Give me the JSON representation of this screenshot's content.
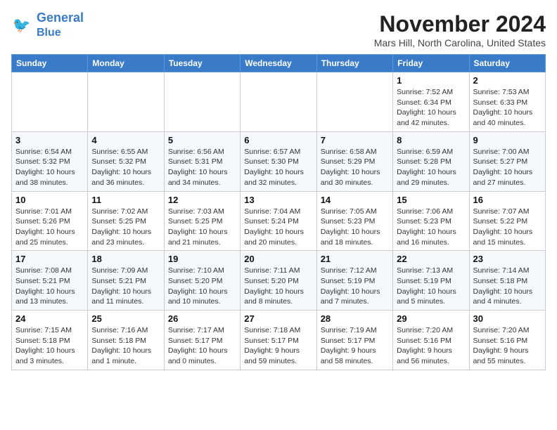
{
  "header": {
    "logo_line1": "General",
    "logo_line2": "Blue",
    "month": "November 2024",
    "location": "Mars Hill, North Carolina, United States"
  },
  "weekdays": [
    "Sunday",
    "Monday",
    "Tuesday",
    "Wednesday",
    "Thursday",
    "Friday",
    "Saturday"
  ],
  "weeks": [
    [
      {
        "day": "",
        "info": ""
      },
      {
        "day": "",
        "info": ""
      },
      {
        "day": "",
        "info": ""
      },
      {
        "day": "",
        "info": ""
      },
      {
        "day": "",
        "info": ""
      },
      {
        "day": "1",
        "info": "Sunrise: 7:52 AM\nSunset: 6:34 PM\nDaylight: 10 hours\nand 42 minutes."
      },
      {
        "day": "2",
        "info": "Sunrise: 7:53 AM\nSunset: 6:33 PM\nDaylight: 10 hours\nand 40 minutes."
      }
    ],
    [
      {
        "day": "3",
        "info": "Sunrise: 6:54 AM\nSunset: 5:32 PM\nDaylight: 10 hours\nand 38 minutes."
      },
      {
        "day": "4",
        "info": "Sunrise: 6:55 AM\nSunset: 5:32 PM\nDaylight: 10 hours\nand 36 minutes."
      },
      {
        "day": "5",
        "info": "Sunrise: 6:56 AM\nSunset: 5:31 PM\nDaylight: 10 hours\nand 34 minutes."
      },
      {
        "day": "6",
        "info": "Sunrise: 6:57 AM\nSunset: 5:30 PM\nDaylight: 10 hours\nand 32 minutes."
      },
      {
        "day": "7",
        "info": "Sunrise: 6:58 AM\nSunset: 5:29 PM\nDaylight: 10 hours\nand 30 minutes."
      },
      {
        "day": "8",
        "info": "Sunrise: 6:59 AM\nSunset: 5:28 PM\nDaylight: 10 hours\nand 29 minutes."
      },
      {
        "day": "9",
        "info": "Sunrise: 7:00 AM\nSunset: 5:27 PM\nDaylight: 10 hours\nand 27 minutes."
      }
    ],
    [
      {
        "day": "10",
        "info": "Sunrise: 7:01 AM\nSunset: 5:26 PM\nDaylight: 10 hours\nand 25 minutes."
      },
      {
        "day": "11",
        "info": "Sunrise: 7:02 AM\nSunset: 5:25 PM\nDaylight: 10 hours\nand 23 minutes."
      },
      {
        "day": "12",
        "info": "Sunrise: 7:03 AM\nSunset: 5:25 PM\nDaylight: 10 hours\nand 21 minutes."
      },
      {
        "day": "13",
        "info": "Sunrise: 7:04 AM\nSunset: 5:24 PM\nDaylight: 10 hours\nand 20 minutes."
      },
      {
        "day": "14",
        "info": "Sunrise: 7:05 AM\nSunset: 5:23 PM\nDaylight: 10 hours\nand 18 minutes."
      },
      {
        "day": "15",
        "info": "Sunrise: 7:06 AM\nSunset: 5:23 PM\nDaylight: 10 hours\nand 16 minutes."
      },
      {
        "day": "16",
        "info": "Sunrise: 7:07 AM\nSunset: 5:22 PM\nDaylight: 10 hours\nand 15 minutes."
      }
    ],
    [
      {
        "day": "17",
        "info": "Sunrise: 7:08 AM\nSunset: 5:21 PM\nDaylight: 10 hours\nand 13 minutes."
      },
      {
        "day": "18",
        "info": "Sunrise: 7:09 AM\nSunset: 5:21 PM\nDaylight: 10 hours\nand 11 minutes."
      },
      {
        "day": "19",
        "info": "Sunrise: 7:10 AM\nSunset: 5:20 PM\nDaylight: 10 hours\nand 10 minutes."
      },
      {
        "day": "20",
        "info": "Sunrise: 7:11 AM\nSunset: 5:20 PM\nDaylight: 10 hours\nand 8 minutes."
      },
      {
        "day": "21",
        "info": "Sunrise: 7:12 AM\nSunset: 5:19 PM\nDaylight: 10 hours\nand 7 minutes."
      },
      {
        "day": "22",
        "info": "Sunrise: 7:13 AM\nSunset: 5:19 PM\nDaylight: 10 hours\nand 5 minutes."
      },
      {
        "day": "23",
        "info": "Sunrise: 7:14 AM\nSunset: 5:18 PM\nDaylight: 10 hours\nand 4 minutes."
      }
    ],
    [
      {
        "day": "24",
        "info": "Sunrise: 7:15 AM\nSunset: 5:18 PM\nDaylight: 10 hours\nand 3 minutes."
      },
      {
        "day": "25",
        "info": "Sunrise: 7:16 AM\nSunset: 5:18 PM\nDaylight: 10 hours\nand 1 minute."
      },
      {
        "day": "26",
        "info": "Sunrise: 7:17 AM\nSunset: 5:17 PM\nDaylight: 10 hours\nand 0 minutes."
      },
      {
        "day": "27",
        "info": "Sunrise: 7:18 AM\nSunset: 5:17 PM\nDaylight: 9 hours\nand 59 minutes."
      },
      {
        "day": "28",
        "info": "Sunrise: 7:19 AM\nSunset: 5:17 PM\nDaylight: 9 hours\nand 58 minutes."
      },
      {
        "day": "29",
        "info": "Sunrise: 7:20 AM\nSunset: 5:16 PM\nDaylight: 9 hours\nand 56 minutes."
      },
      {
        "day": "30",
        "info": "Sunrise: 7:20 AM\nSunset: 5:16 PM\nDaylight: 9 hours\nand 55 minutes."
      }
    ]
  ]
}
